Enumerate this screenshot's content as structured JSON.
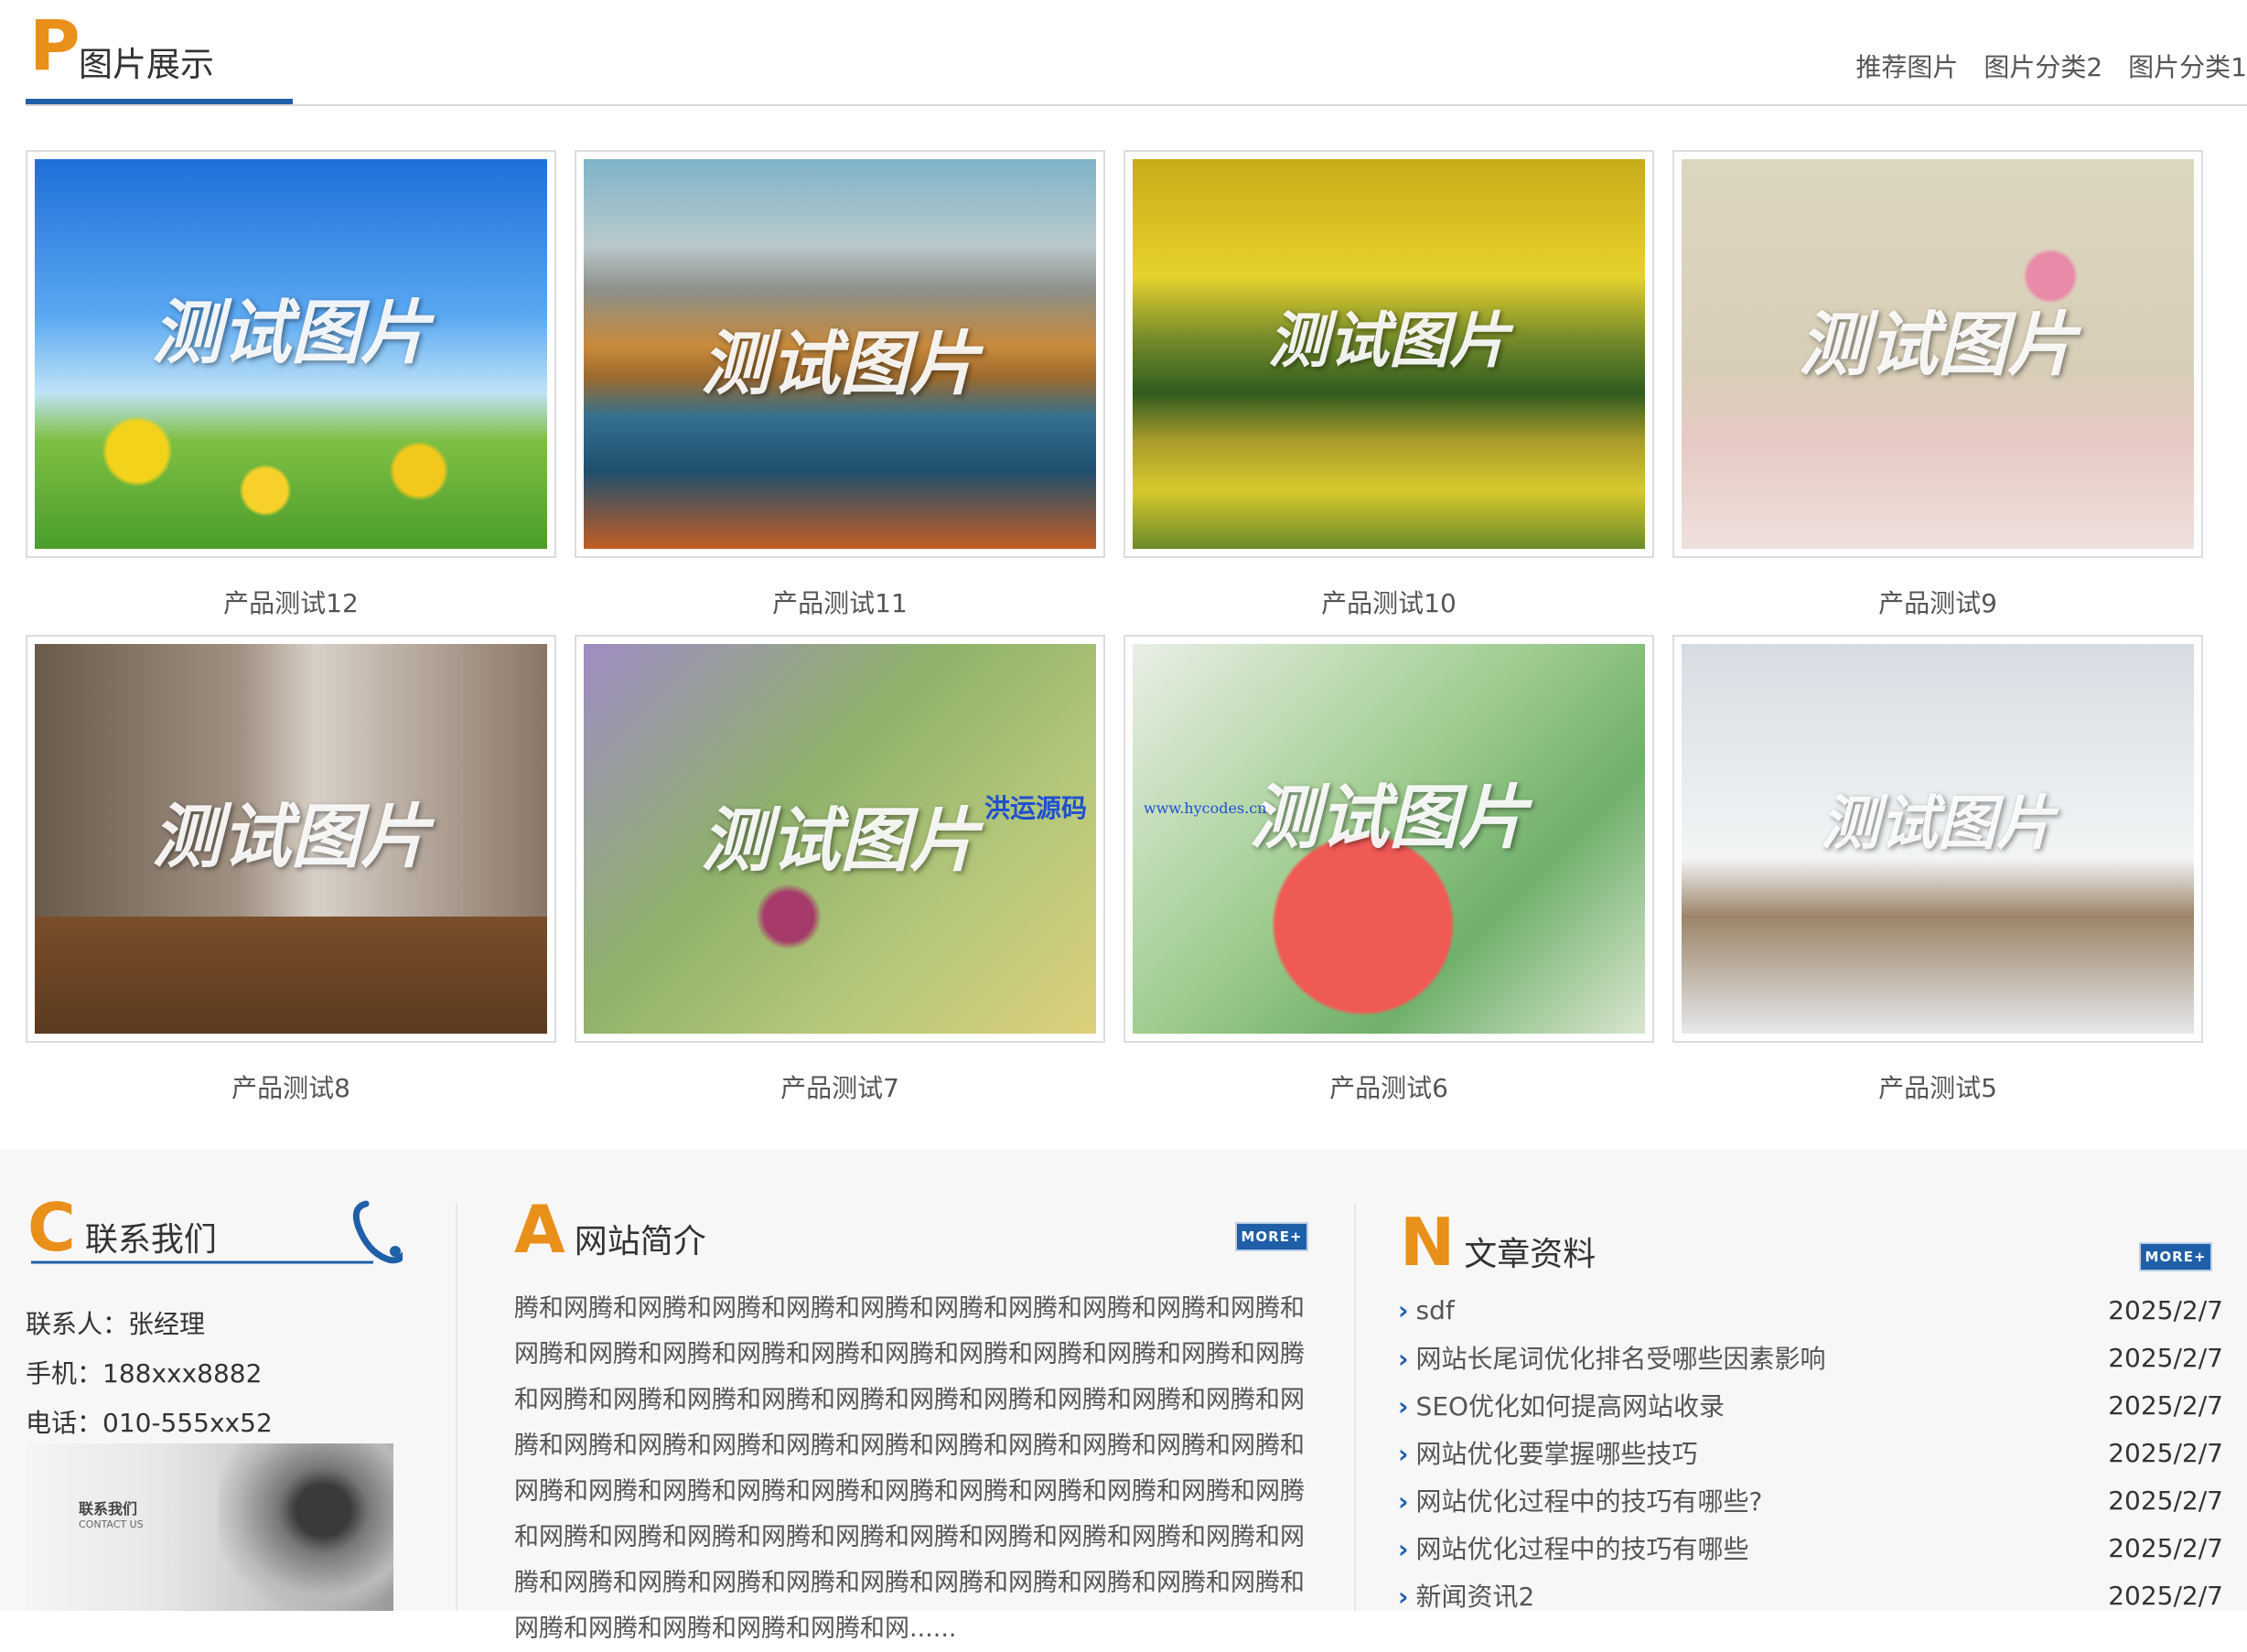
{
  "header": {
    "letter": "P",
    "title": "图片展示",
    "categories": [
      "推荐图片",
      "图片分类2",
      "图片分类1"
    ]
  },
  "watermark_text": "测试图片",
  "site_watermark": {
    "name": "洪运源码",
    "url": "www.hycodes.cn"
  },
  "gallery": [
    {
      "caption": "产品测试12"
    },
    {
      "caption": "产品测试11"
    },
    {
      "caption": "产品测试10"
    },
    {
      "caption": "产品测试9"
    },
    {
      "caption": "产品测试8"
    },
    {
      "caption": "产品测试7"
    },
    {
      "caption": "产品测试6"
    },
    {
      "caption": "产品测试5"
    }
  ],
  "contact": {
    "letter": "C",
    "title": "联系我们",
    "person": "联系人：张经理",
    "mobile": "手机：188xxx8882",
    "phone": "电话：010-555xx52",
    "image_text_cn": "联系我们",
    "image_text_en": "CONTACT US"
  },
  "intro": {
    "letter": "A",
    "title": "网站简介",
    "more": "MORE+",
    "text": "腾和网腾和网腾和网腾和网腾和网腾和网腾和网腾和网腾和网腾和网腾和网腾和网腾和网腾和网腾和网腾和网腾和网腾和网腾和网腾和网腾和网腾和网腾和网腾和网腾和网腾和网腾和网腾和网腾和网腾和网腾和网腾和网腾和网腾和网腾和网腾和网腾和网腾和网腾和网腾和网腾和网腾和网腾和网腾和网腾和网腾和网腾和网腾和网腾和网腾和网腾和网腾和网腾和网腾和网腾和网腾和网腾和网腾和网腾和网腾和网腾和网腾和网腾和网腾和网腾和网腾和网腾和网腾和网腾和网腾和网腾和网腾和网腾和网腾和网腾和网腾和网腾和网腾和网腾和网腾和网......"
  },
  "articles": {
    "letter": "N",
    "title": "文章资料",
    "more": "MORE+",
    "items": [
      {
        "title": "sdf",
        "date": "2025/2/7"
      },
      {
        "title": "网站长尾词优化排名受哪些因素影响",
        "date": "2025/2/7"
      },
      {
        "title": "SEO优化如何提高网站收录",
        "date": "2025/2/7"
      },
      {
        "title": "网站优化要掌握哪些技巧",
        "date": "2025/2/7"
      },
      {
        "title": "网站优化过程中的技巧有哪些?",
        "date": "2025/2/7"
      },
      {
        "title": "网站优化过程中的技巧有哪些",
        "date": "2025/2/7"
      },
      {
        "title": "新闻资讯2",
        "date": "2025/2/7"
      }
    ]
  }
}
